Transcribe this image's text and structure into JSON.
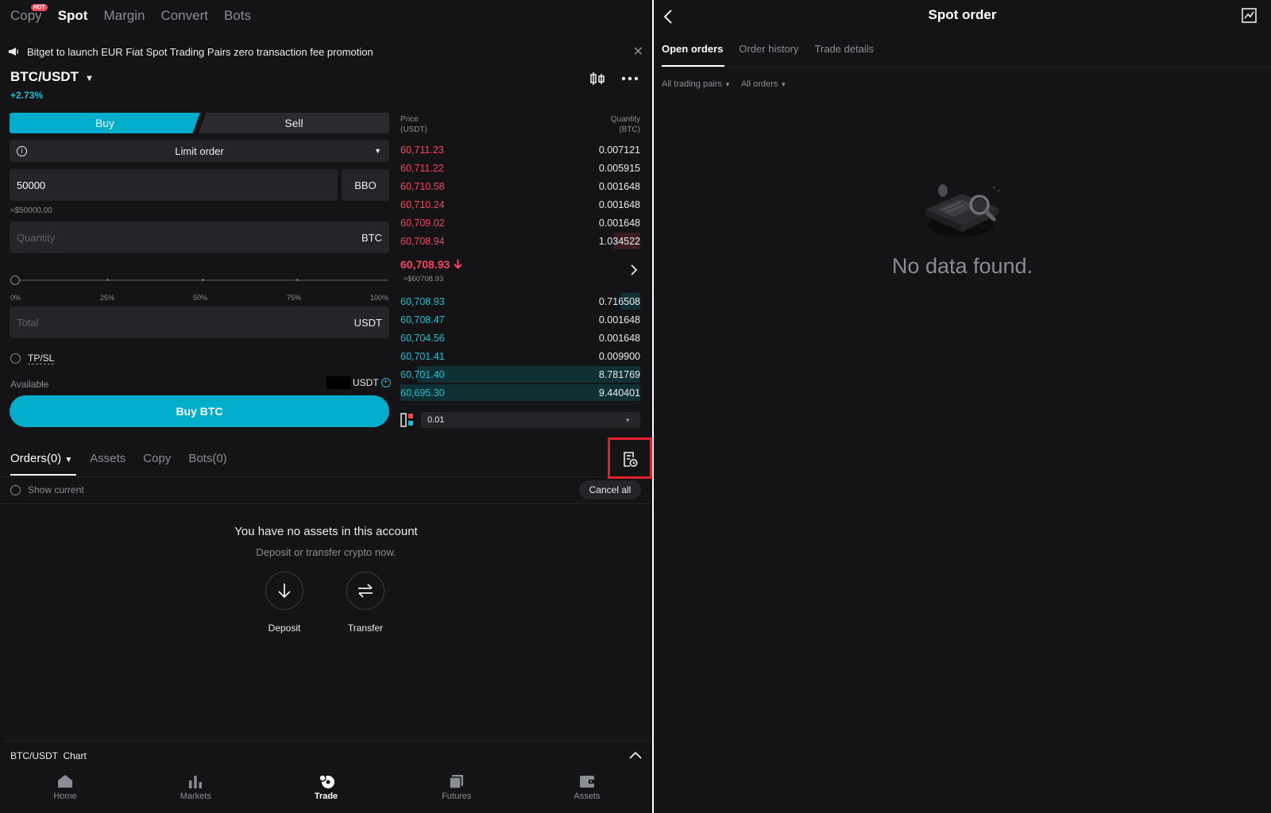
{
  "left": {
    "top_tabs": [
      {
        "label": "Copy",
        "badge": "HOT"
      },
      {
        "label": "Spot"
      },
      {
        "label": "Margin"
      },
      {
        "label": "Convert"
      },
      {
        "label": "Bots"
      }
    ],
    "announcement": "Bitget to launch EUR Fiat Spot Trading Pairs zero transaction fee promotion",
    "pair": "BTC/USDT",
    "change": "+2.73%",
    "trade_form": {
      "buy_tab": "Buy",
      "sell_tab": "Sell",
      "order_type": "Limit order",
      "price_value": "50000",
      "bbo_label": "BBO",
      "price_approx": "≈$50000.00",
      "quantity_placeholder": "Quantity",
      "quantity_unit": "BTC",
      "slider_percent": 0,
      "slider_marks": [
        "0%",
        "25%",
        "50%",
        "75%",
        "100%"
      ],
      "total_placeholder": "Total",
      "total_unit": "USDT",
      "tpsl_label": "TP/SL",
      "available_label": "Available",
      "available_unit": "USDT",
      "buy_button": "Buy BTC"
    },
    "order_book": {
      "price_header": "Price",
      "price_unit": "(USDT)",
      "quantity_header": "Quantity",
      "quantity_unit": "(BTC)",
      "asks": [
        {
          "price": "60,711.23",
          "qty": "0.007121",
          "depth": 0
        },
        {
          "price": "60,711.22",
          "qty": "0.005915",
          "depth": 0
        },
        {
          "price": "60,710.58",
          "qty": "0.001648",
          "depth": 0
        },
        {
          "price": "60,710.24",
          "qty": "0.001648",
          "depth": 0
        },
        {
          "price": "60,709.02",
          "qty": "0.001648",
          "depth": 0
        },
        {
          "price": "60,708.94",
          "qty": "1.034522",
          "depth": 0.11
        }
      ],
      "last_price": "60,708.93",
      "last_price_fiat": "≈$60708.93",
      "bids": [
        {
          "price": "60,708.93",
          "qty": "0.716508",
          "depth": 0.08
        },
        {
          "price": "60,708.47",
          "qty": "0.001648",
          "depth": 0
        },
        {
          "price": "60,704.56",
          "qty": "0.001648",
          "depth": 0
        },
        {
          "price": "60,701.41",
          "qty": "0.009900",
          "depth": 0
        },
        {
          "price": "60,701.40",
          "qty": "8.781769",
          "depth": 0.93
        },
        {
          "price": "60,695.30",
          "qty": "9.440401",
          "depth": 1.0
        }
      ],
      "precision": "0.01"
    },
    "lower_tabs": [
      "Orders(0)",
      "Assets",
      "Copy",
      "Bots(0)"
    ],
    "show_current_label": "Show current",
    "cancel_all_label": "Cancel all",
    "empty_title": "You have no assets in this account",
    "empty_subtitle": "Deposit or transfer crypto now.",
    "deposit_label": "Deposit",
    "transfer_label": "Transfer",
    "chart_bar_label": "BTC/USDT  Chart",
    "bottom_nav": [
      "Home",
      "Markets",
      "Trade",
      "Futures",
      "Assets"
    ],
    "colors": {
      "accent": "#00aecb",
      "ask": "#f6465d",
      "bid": "#1ebed1",
      "highlight": "#e5202b"
    }
  },
  "right": {
    "title": "Spot order",
    "tabs": [
      "Open orders",
      "Order history",
      "Trade details"
    ],
    "filters": [
      "All trading pairs",
      "All orders"
    ],
    "no_data": "No data found."
  }
}
